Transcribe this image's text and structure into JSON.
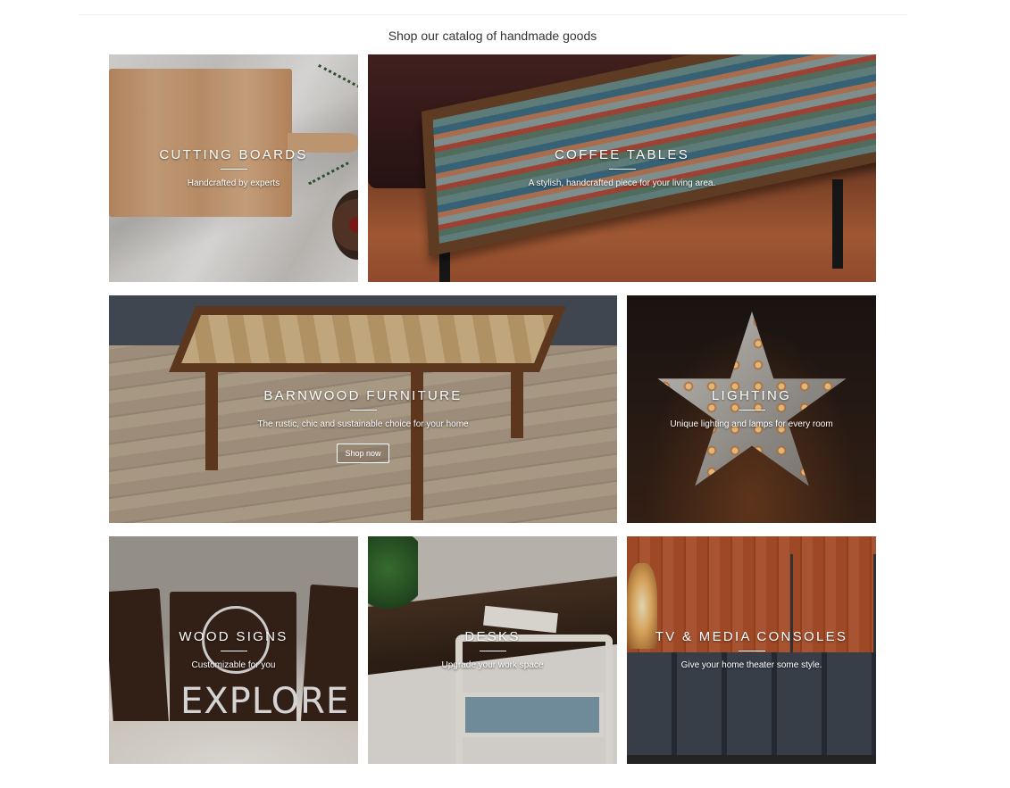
{
  "heading": "Shop our catalog of handmade goods",
  "tiles": [
    {
      "title": "CUTTING BOARDS",
      "subtitle": "Handcrafted by experts"
    },
    {
      "title": "COFFEE TABLES",
      "subtitle": "A stylish, handcrafted piece for your living area."
    },
    {
      "title": "BARNWOOD FURNITURE",
      "subtitle": "The rustic, chic and sustainable choice for your home",
      "button": "Shop now"
    },
    {
      "title": "LIGHTING",
      "subtitle": "Unique lighting and lamps for every room"
    },
    {
      "title": "WOOD SIGNS",
      "subtitle": "Customizable for you",
      "sign_text": "EXPLORE"
    },
    {
      "title": "DESKS",
      "subtitle": "Upgrade your work space"
    },
    {
      "title": "TV & MEDIA CONSOLES",
      "subtitle": "Give your home theater some style."
    }
  ]
}
